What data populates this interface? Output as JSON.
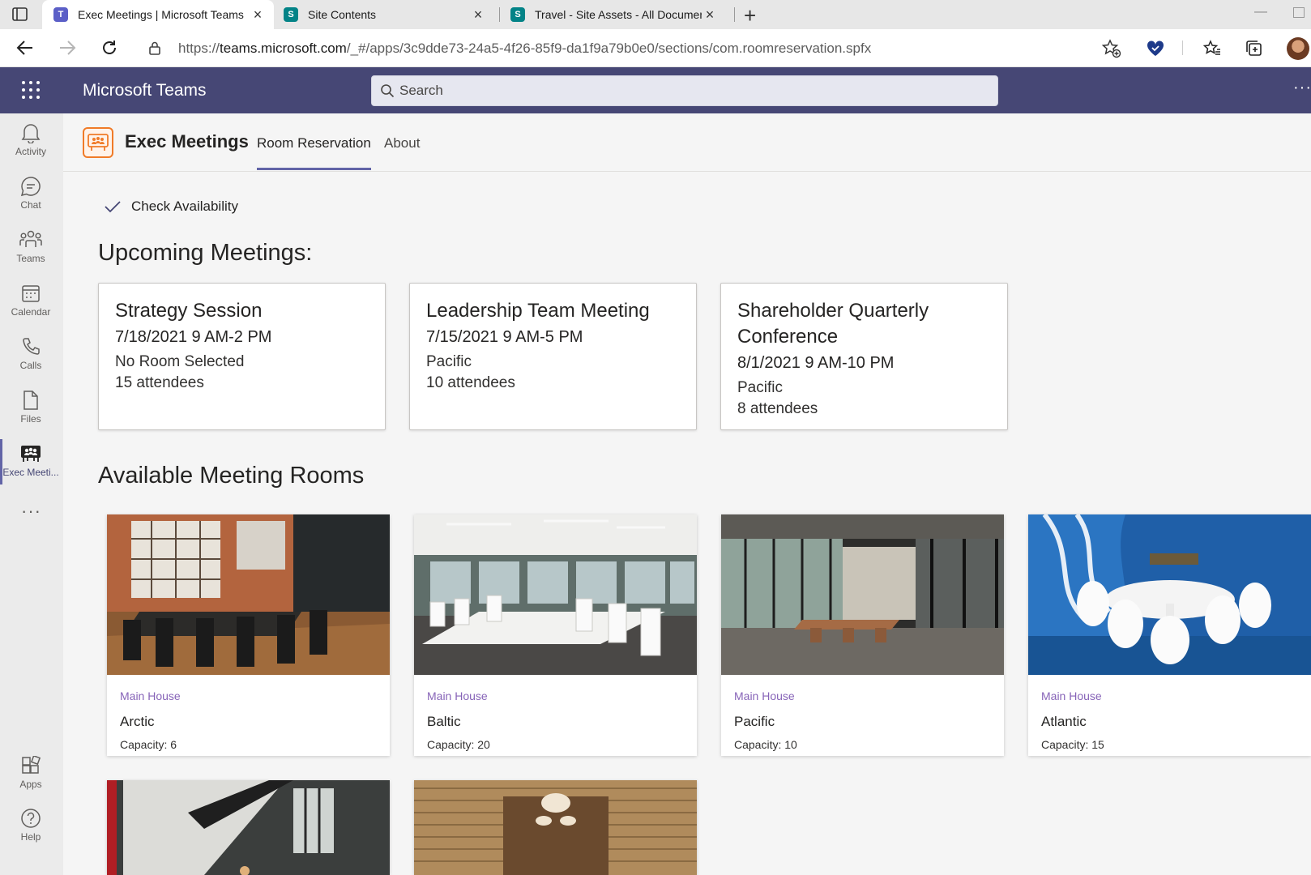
{
  "browser": {
    "tabs": [
      {
        "title": "Exec Meetings | Microsoft Teams",
        "icon": "teams-icon",
        "active": true
      },
      {
        "title": "Site Contents",
        "icon": "sharepoint-icon",
        "active": false
      },
      {
        "title": "Travel - Site Assets - All Documents",
        "icon": "sharepoint-icon",
        "active": false
      }
    ],
    "url_prefix": "https://",
    "url_domain": "teams.microsoft.com",
    "url_path": "/_#/apps/3c9dde73-24a5-4f26-85f9-da1f9a79b0e0/sections/com.roomreservation.spfx"
  },
  "teams": {
    "app_name": "Microsoft Teams",
    "search_placeholder": "Search",
    "rail": [
      {
        "label": "Activity",
        "icon": "bell-icon"
      },
      {
        "label": "Chat",
        "icon": "chat-icon"
      },
      {
        "label": "Teams",
        "icon": "teams-people-icon"
      },
      {
        "label": "Calendar",
        "icon": "calendar-icon"
      },
      {
        "label": "Calls",
        "icon": "phone-icon"
      },
      {
        "label": "Files",
        "icon": "file-icon"
      },
      {
        "label": "Exec Meeti...",
        "icon": "exec-meetings-icon",
        "active": true
      }
    ],
    "rail_bottom": [
      {
        "label": "Apps",
        "icon": "apps-icon"
      },
      {
        "label": "Help",
        "icon": "help-icon"
      }
    ]
  },
  "app": {
    "title": "Exec Meetings",
    "tabs": [
      {
        "label": "Room Reservation",
        "active": true
      },
      {
        "label": "About",
        "active": false
      }
    ],
    "check_availability": "Check Availability",
    "upcoming_title": "Upcoming Meetings:",
    "meetings": [
      {
        "title": "Strategy Session",
        "datetime": "7/18/2021 9 AM-2 PM",
        "location": "No Room Selected",
        "attendees": "15 attendees"
      },
      {
        "title": "Leadership Team Meeting",
        "datetime": "7/15/2021 9 AM-5 PM",
        "location": "Pacific",
        "attendees": "10 attendees"
      },
      {
        "title": "Shareholder Quarterly Conference",
        "datetime": "8/1/2021 9 AM-10 PM",
        "location": "Pacific",
        "attendees": "8 attendees"
      }
    ],
    "rooms_title": "Available Meeting Rooms",
    "rooms": [
      {
        "location": "Main House",
        "name": "Arctic",
        "capacity": "Capacity: 6"
      },
      {
        "location": "Main House",
        "name": "Baltic",
        "capacity": "Capacity: 20"
      },
      {
        "location": "Main House",
        "name": "Pacific",
        "capacity": "Capacity: 10"
      },
      {
        "location": "Main House",
        "name": "Atlantic",
        "capacity": "Capacity: 15"
      }
    ]
  },
  "colors": {
    "teams_header": "#464775",
    "accent": "#6264a7",
    "room_location": "#8764b8"
  }
}
